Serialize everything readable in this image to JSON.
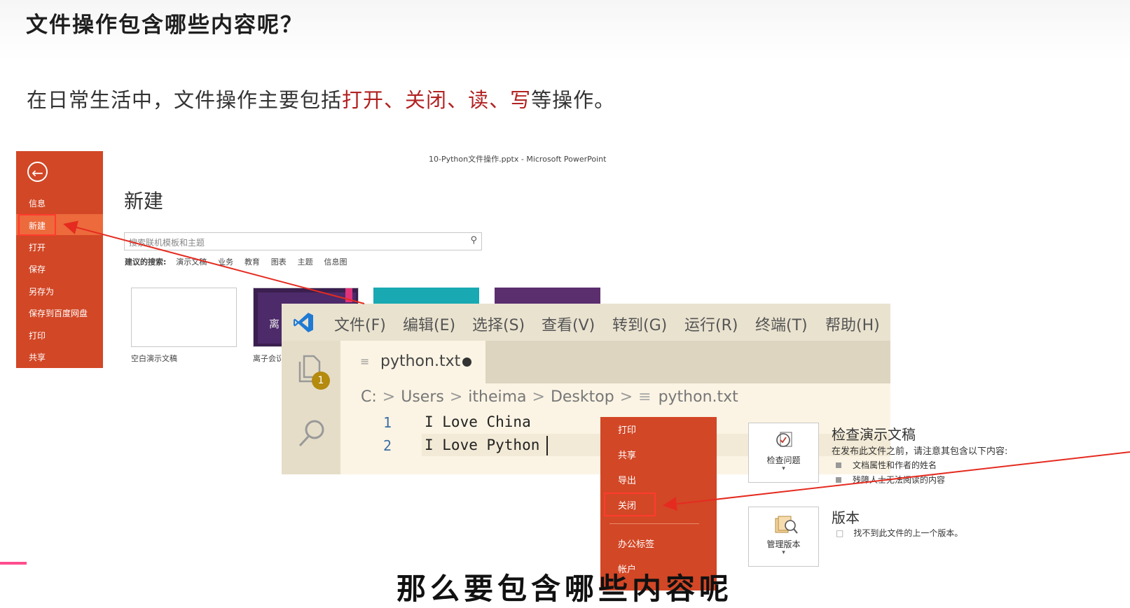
{
  "slide": {
    "title": "文件操作包含哪些内容呢？",
    "body_prefix": "在日常生活中，文件操作主要包括",
    "hl_open": "打开",
    "sep1": "、",
    "hl_close": "关闭",
    "sep2": "、",
    "hl_read": "读",
    "sep3": "、",
    "hl_write": "写",
    "body_suffix": "等操作。"
  },
  "powerpoint": {
    "window_title": "10-Python文件操作.pptx - Microsoft PowerPoint",
    "back_icon": "back-arrow-icon",
    "menu": [
      "信息",
      "新建",
      "打开",
      "保存",
      "另存为",
      "保存到百度网盘",
      "打印",
      "共享"
    ],
    "heading": "新建",
    "search_placeholder": "搜索联机模板和主题",
    "suggest_label": "建议的搜索:",
    "suggest_items": [
      "演示文稿",
      "业务",
      "教育",
      "图表",
      "主题",
      "信息图"
    ],
    "thumb_caption_blank": "空白演示文稿",
    "thumb_caption_purple": "离子会议",
    "thumb_purple_text": "离"
  },
  "vscode": {
    "menus": [
      "文件(F)",
      "编辑(E)",
      "选择(S)",
      "查看(V)",
      "转到(G)",
      "运行(R)",
      "终端(T)",
      "帮助(H)"
    ],
    "badge": "1",
    "tab_label": "python.txt",
    "breadcrumb": [
      "C:",
      "Users",
      "itheima",
      "Desktop",
      "python.txt"
    ],
    "lines": [
      {
        "num": "1",
        "text": "I Love China"
      },
      {
        "num": "2",
        "text": "I Love Python"
      }
    ]
  },
  "close_menu": {
    "items": [
      "打印",
      "共享",
      "导出",
      "关闭",
      "办公标签",
      "帐户"
    ]
  },
  "info": {
    "inspect_button": "检查问题",
    "inspect_title": "检查演示文稿",
    "inspect_desc": "在发布此文件之前，请注意其包含以下内容:",
    "inspect_bullets": [
      "文档属性和作者的姓名",
      "残障人士无法阅读的内容"
    ],
    "version_button": "管理版本",
    "version_title": "版本",
    "version_desc": "找不到此文件的上一个版本。"
  },
  "subtitle": "那么要包含哪些内容呢",
  "colors": {
    "office_orange": "#d24726",
    "highlight_red": "#b22222",
    "annotation_red": "#ff3b2f",
    "vscode_blue": "#1f7ad4"
  }
}
